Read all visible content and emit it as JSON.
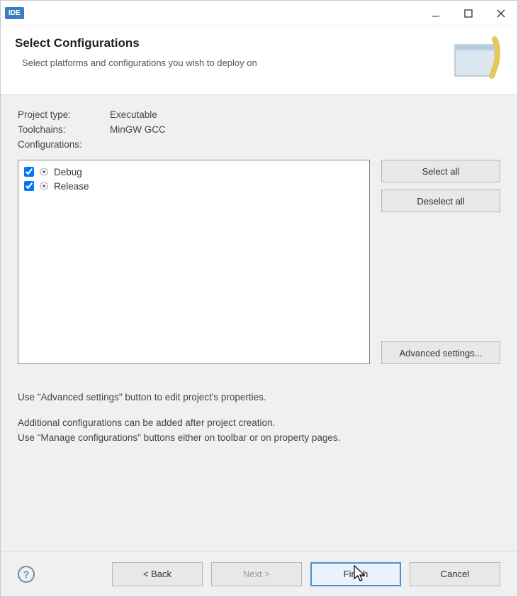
{
  "titlebar": {
    "badge": "IDE"
  },
  "header": {
    "title": "Select Configurations",
    "subtitle": "Select platforms and configurations you wish to deploy on"
  },
  "info": {
    "projectTypeLabel": "Project type:",
    "projectTypeValue": "Executable",
    "toolchainsLabel": "Toolchains:",
    "toolchainsValue": "MinGW GCC",
    "configurationsLabel": "Configurations:"
  },
  "configs": [
    {
      "label": "Debug",
      "checked": true
    },
    {
      "label": "Release",
      "checked": true
    }
  ],
  "buttons": {
    "selectAll": "Select all",
    "deselectAll": "Deselect all",
    "advanced": "Advanced settings..."
  },
  "hints": {
    "line1": "Use \"Advanced settings\" button to edit project's properties.",
    "line2": "Additional configurations can be added after project creation.",
    "line3": "Use \"Manage configurations\" buttons either on toolbar or on property pages."
  },
  "footer": {
    "back": "< Back",
    "next": "Next >",
    "finish": "Finish",
    "cancel": "Cancel"
  }
}
